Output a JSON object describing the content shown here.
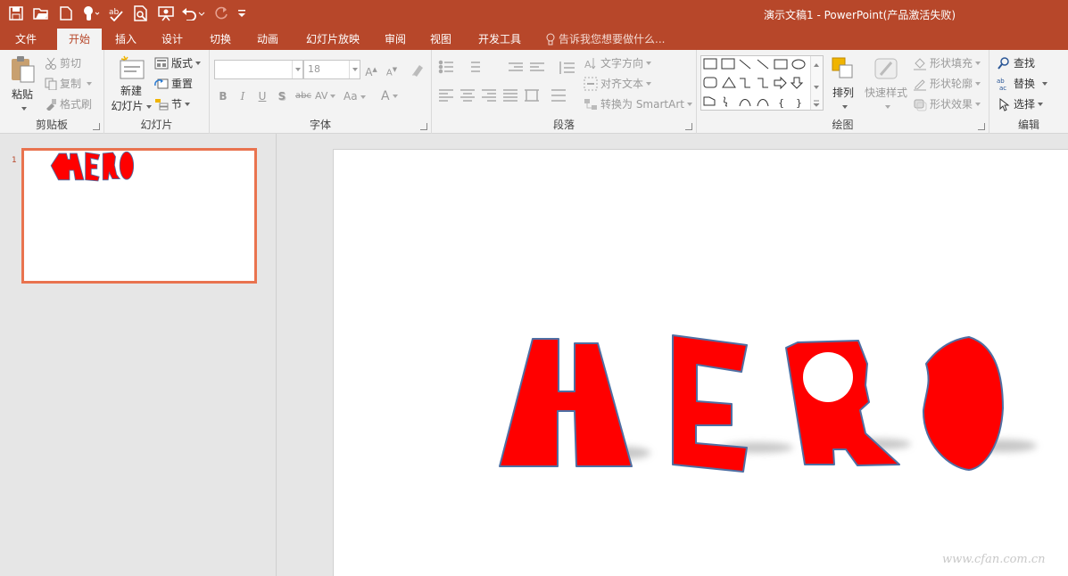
{
  "window": {
    "title": "演示文稿1 - PowerPoint(产品激活失败)",
    "accent_color": "#b7472a"
  },
  "quick_access": {
    "icons": [
      "save-icon",
      "open-icon",
      "new-icon",
      "touch-mode-icon",
      "spelling-icon",
      "print-preview-icon",
      "presenter-icon",
      "undo-icon",
      "redo-icon",
      "customize-icon"
    ]
  },
  "tabs": {
    "file": "文件",
    "home": "开始",
    "insert": "插入",
    "design": "设计",
    "transitions": "切换",
    "animations": "动画",
    "slideshow": "幻灯片放映",
    "review": "审阅",
    "view": "视图",
    "developer": "开发工具",
    "active": "开始"
  },
  "tell_me": "告诉我您想要做什么...",
  "ribbon": {
    "clipboard": {
      "label": "剪贴板",
      "paste": "粘贴",
      "cut": "剪切",
      "copy": "复制",
      "format_painter": "格式刷"
    },
    "slides": {
      "label": "幻灯片",
      "new_slide_line1": "新建",
      "new_slide_line2": "幻灯片",
      "layout": "版式",
      "reset": "重置",
      "section": "节"
    },
    "font": {
      "label": "字体",
      "font_name": "",
      "font_size": "18",
      "bold": "B",
      "italic": "I",
      "underline": "U",
      "shadow": "S",
      "strike": "abc",
      "spacing": "AV",
      "case": "Aa",
      "color": "A"
    },
    "paragraph": {
      "label": "段落",
      "text_direction": "文字方向",
      "align_text": "对齐文本",
      "convert_smartart": "转换为 SmartArt"
    },
    "drawing": {
      "label": "绘图",
      "arrange": "排列",
      "quick_styles": "快速样式",
      "shape_fill": "形状填充",
      "shape_outline": "形状轮廓",
      "shape_effects": "形状效果"
    },
    "editing": {
      "label": "编辑",
      "find": "查找",
      "replace": "替换",
      "select": "选择"
    }
  },
  "thumbnails": [
    {
      "number": "1",
      "selected": true
    }
  ],
  "slide": {
    "word": "HERO",
    "shape_fill": "#ff0000",
    "shape_outline": "#4f6fa3"
  },
  "watermark": "www.cfan.com.cn"
}
